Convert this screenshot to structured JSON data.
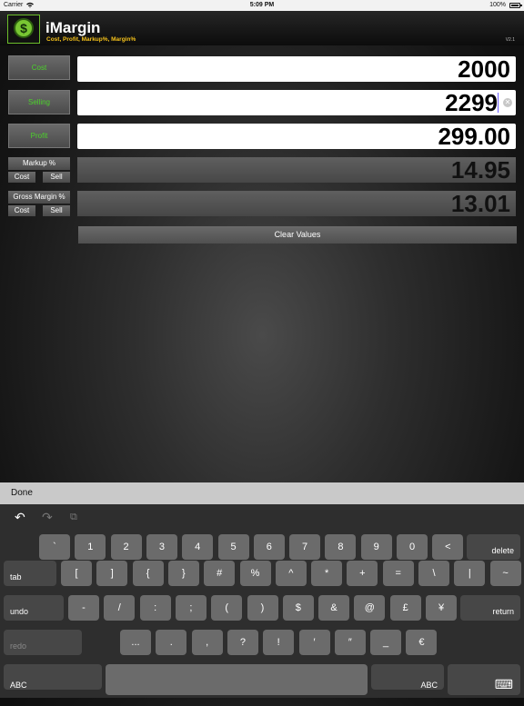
{
  "status_bar": {
    "carrier": "Carrier",
    "time": "5:09 PM",
    "battery": "100%"
  },
  "header": {
    "title": "iMargin",
    "subtitle": "Cost, Profit, Markup%, Margin%",
    "version": "V2.1",
    "logo_symbol": "$"
  },
  "sidebar": {
    "cost_label": "Cost",
    "selling_label": "Selling",
    "profit_label": "Profit",
    "markup": {
      "label": "Markup %",
      "cost": "Cost",
      "sell": "Sell"
    },
    "gross_margin": {
      "label": "Gross Margin %",
      "cost": "Cost",
      "sell": "Sell"
    }
  },
  "fields": {
    "cost_value": "2000",
    "selling_value": "2299",
    "profit_value": "299.00",
    "markup_value": "14.95",
    "margin_value": "13.01"
  },
  "clear_label": "Clear Values",
  "keyboard": {
    "done_label": "Done",
    "toolbar": {
      "undo_icon": "↶",
      "redo_icon": "↷",
      "paste_icon": "⧉"
    },
    "row1": [
      "`",
      "1",
      "2",
      "3",
      "4",
      "5",
      "6",
      "7",
      "8",
      "9",
      "0",
      "<",
      ">"
    ],
    "delete": "delete",
    "tab": "tab",
    "row2": [
      "[",
      "]",
      "{",
      "}",
      "#",
      "%",
      "^",
      "*",
      "+",
      "=",
      "\\",
      "|",
      "~"
    ],
    "undo": "undo",
    "row3": [
      "-",
      "/",
      ":",
      ";",
      "(",
      ")",
      "$",
      "&",
      "@",
      "£",
      "¥"
    ],
    "return": "return",
    "redo": "redo",
    "row4": [
      "...",
      ".",
      ",",
      "?",
      "!",
      "′",
      "″",
      "_",
      "€"
    ],
    "abc_left": "ABC",
    "abc_right": "ABC",
    "hide_keyboard_icon": "⌨"
  },
  "colors": {
    "accent_green": "#4cd22b",
    "subtitle_gold": "#f5c21b",
    "cursor": "#6b5cff"
  }
}
